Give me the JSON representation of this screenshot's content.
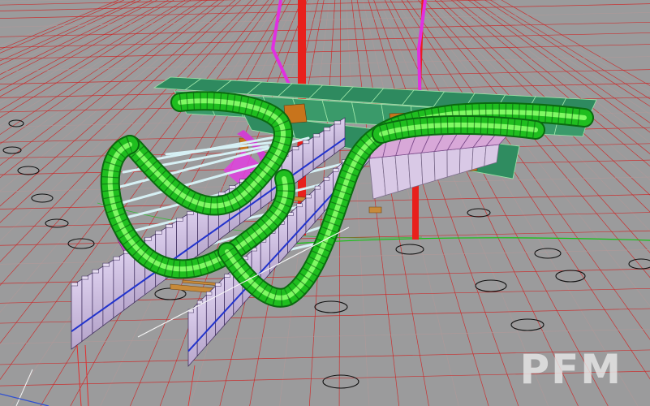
{
  "viewport": {
    "background": "#9b9b9c",
    "watermark": "PFM"
  },
  "colors": {
    "grid_major": "#d02020",
    "grid_minor": "#b09a9a",
    "circle_marker": "#111111",
    "roof_panel": "#2e8a5f",
    "roof_edge": "#9ee6a8",
    "bracket": "#c8741c",
    "ribbon_core": "#22c322",
    "ribbon_edge": "#b6ff7a",
    "ribbon_underside": "#d040d0",
    "tube": "#cfe8ee",
    "column_red": "#e8201c",
    "column_magenta": "#e030e0",
    "wall_face": "#c9b8dc",
    "wall_edge": "#3b2a5a",
    "wall_stripe": "#2233cc",
    "beam_wood": "#c78a3a",
    "white_line": "#f4f4f4",
    "green_line": "#12c312",
    "red_line": "#e03030"
  }
}
